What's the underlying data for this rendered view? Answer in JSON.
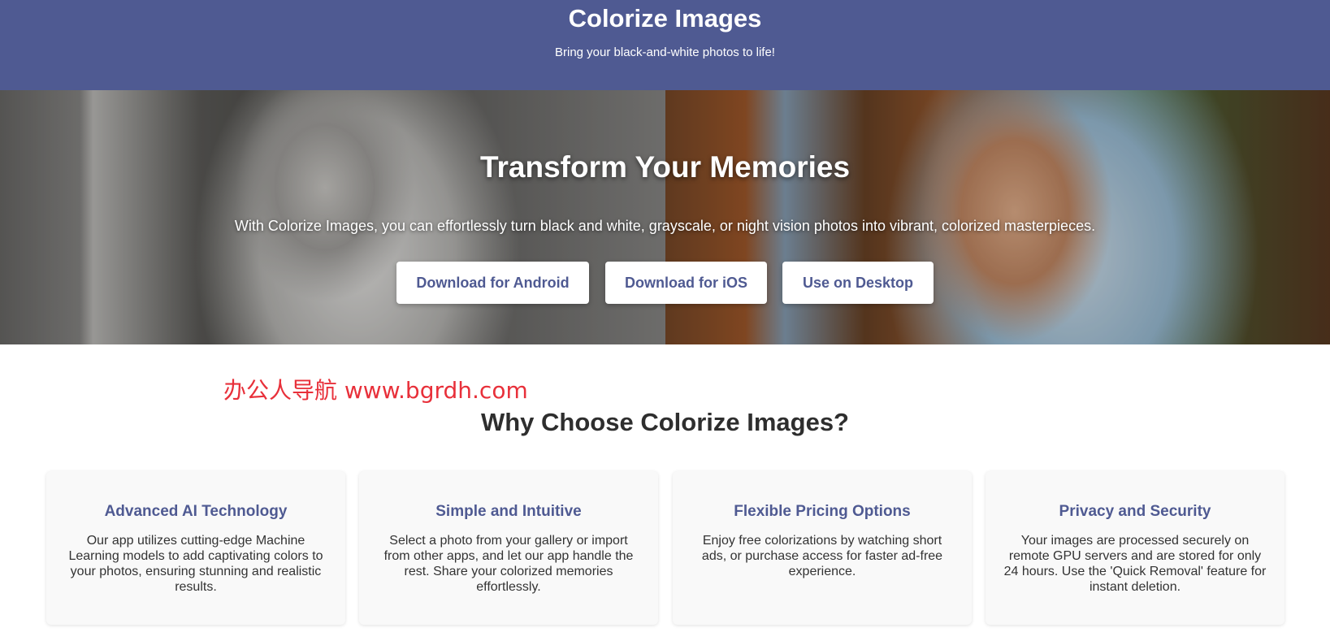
{
  "header": {
    "title": "Colorize Images",
    "subtitle": "Bring your black-and-white photos to life!"
  },
  "hero": {
    "heading": "Transform Your Memories",
    "lead": "With Colorize Images, you can effortlessly turn black and white, grayscale, or night vision photos into vibrant, colorized masterpieces.",
    "buttons": {
      "android": "Download for Android",
      "ios": "Download for iOS",
      "desktop": "Use on Desktop"
    }
  },
  "watermark": "办公人导航 www.bgrdh.com",
  "features": {
    "title": "Why Choose Colorize Images?",
    "cards": [
      {
        "title": "Advanced AI Technology",
        "body": "Our app utilizes cutting-edge Machine Learning models to add captivating colors to your photos, ensuring stunning and realistic results."
      },
      {
        "title": "Simple and Intuitive",
        "body": "Select a photo from your gallery or import from other apps, and let our app handle the rest. Share your colorized memories effortlessly."
      },
      {
        "title": "Flexible Pricing Options",
        "body": "Enjoy free colorizations by watching short ads, or purchase access for faster ad-free experience."
      },
      {
        "title": "Privacy and Security",
        "body": "Your images are processed securely on remote GPU servers and are stored for only 24 hours. Use the 'Quick Removal' feature for instant deletion."
      }
    ]
  },
  "colors": {
    "brand": "#4f5a92",
    "watermark": "#e8303a"
  }
}
